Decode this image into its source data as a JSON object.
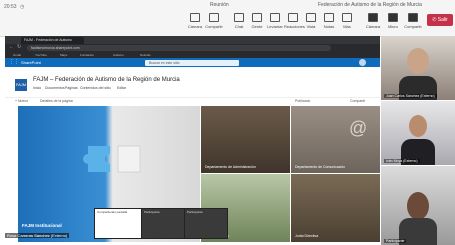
{
  "teams": {
    "time": "20:53",
    "window_title": "Reunión",
    "meeting_title": "Federación de Autismo de la Región de Murcia",
    "buttons": [
      {
        "label": "Cámara",
        "icon": "camera-icon"
      },
      {
        "label": "Compartir",
        "icon": "share-icon"
      },
      {
        "label": "Chat",
        "icon": "chat-icon"
      },
      {
        "label": "Gente",
        "icon": "people-icon"
      },
      {
        "label": "Levantar",
        "icon": "hand-icon"
      },
      {
        "label": "Reacciones",
        "icon": "reactions-icon"
      },
      {
        "label": "Vista",
        "icon": "view-icon"
      },
      {
        "label": "Notas",
        "icon": "notes-icon"
      },
      {
        "label": "Más",
        "icon": "more-icon"
      },
      {
        "label": "Cámara",
        "icon": "camera-icon"
      },
      {
        "label": "Micro",
        "icon": "mic-icon"
      },
      {
        "label": "Compartir",
        "icon": "share-icon"
      }
    ],
    "leave_label": "Salir"
  },
  "browser": {
    "tab_title": "FAJM - Federación de Autismo",
    "url": "fautismomurcia.sharepoint.com",
    "bookmarks": [
      "Gmail",
      "YouTube",
      "Maps",
      "Fundación",
      "Autismo",
      "Noticias"
    ]
  },
  "sharepoint": {
    "app_label": "SharePoint",
    "search_placeholder": "Buscar en este sitio",
    "logo_text": "FAJM",
    "site_title": "FAJM – Federación de Autismo de la Región de Murcia",
    "nav": [
      "Inicio",
      "Documentos",
      "Páginas",
      "Contenidos del sitio",
      "Editar"
    ],
    "commands": [
      "+ Nuevo",
      "Detalles de la página",
      "Publicado",
      "Compartir"
    ],
    "tiles": [
      {
        "title": "FAJM Institucional",
        "subtitle": "VER INFORMACIÓN"
      },
      {
        "title": "Departamento de Administración"
      },
      {
        "title": "Departamento de Comunicación"
      },
      {
        "title": "Área Proyectos"
      },
      {
        "title": "Junta Directiva"
      }
    ]
  },
  "participants": [
    {
      "name": "Juan Carlos Sánchez (Externo)"
    },
    {
      "name": "Iván Moya (Externo)"
    },
    {
      "name": "Participante"
    }
  ],
  "presenter": "Rosa Carreras Sánchez (Externo)",
  "thumbnails": [
    "Compartiendo pantalla",
    "Participante",
    "Participante"
  ]
}
